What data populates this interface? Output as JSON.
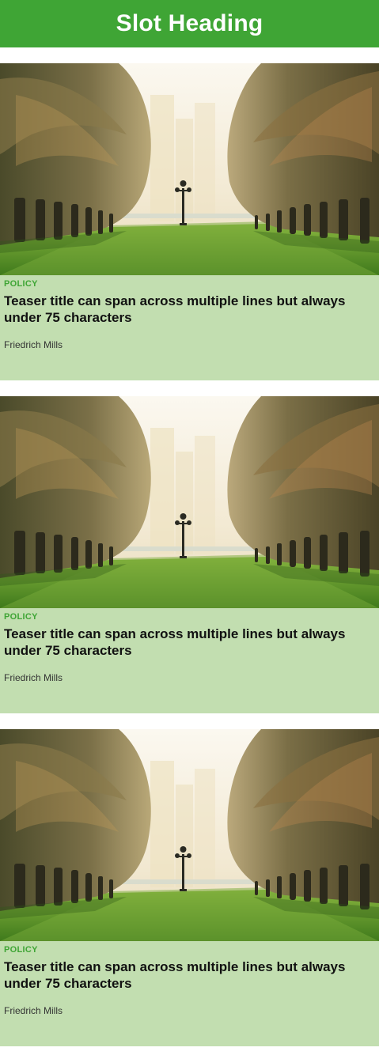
{
  "slot": {
    "heading": "Slot Heading"
  },
  "teasers": [
    {
      "image": "palm-avenue-park-image",
      "category": "POLICY",
      "title": "Teaser title can span across multiple lines but always under 75 characters",
      "author": "Friedrich Mills"
    },
    {
      "image": "palm-avenue-park-image",
      "category": "POLICY",
      "title": "Teaser title can span across multiple lines but always under 75 characters",
      "author": "Friedrich Mills"
    },
    {
      "image": "palm-avenue-park-image",
      "category": "POLICY",
      "title": "Teaser title can span across multiple lines but always under 75 characters",
      "author": "Friedrich Mills"
    }
  ],
  "colors": {
    "accent_green": "#3fa535",
    "card_background": "#c2deb0",
    "title_text": "#111111"
  }
}
